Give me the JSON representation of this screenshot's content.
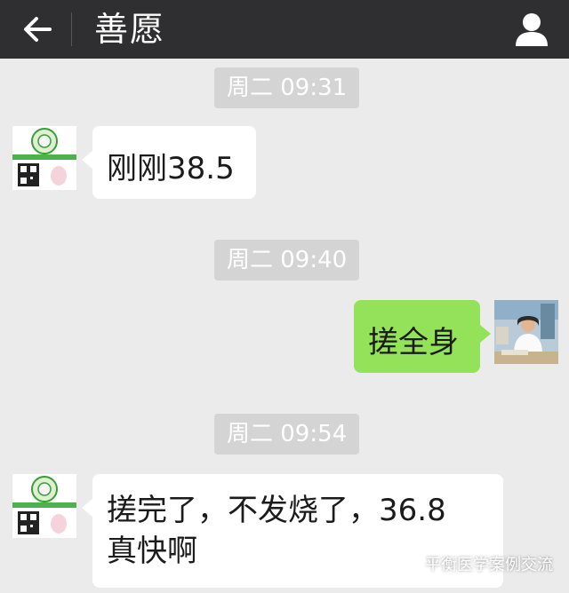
{
  "header": {
    "back_icon": "arrow-left-icon",
    "title": "善愿",
    "profile_icon": "person-icon"
  },
  "messages": [
    {
      "type": "time",
      "text": "周二 09:31"
    },
    {
      "type": "message",
      "side": "left",
      "text": "刚刚38.5"
    },
    {
      "type": "time",
      "text": "周二 09:40"
    },
    {
      "type": "message",
      "side": "right",
      "text": "搓全身"
    },
    {
      "type": "time",
      "text": "周二 09:54"
    },
    {
      "type": "message",
      "side": "left",
      "lines": [
        "搓完了，不发烧了，36.8",
        "真快啊"
      ]
    }
  ],
  "watermark": {
    "icon": "wechat-icon",
    "text": "平衡医学案例交流"
  },
  "colors": {
    "topbar": "#2f2f31",
    "background": "#ebebeb",
    "bubble_self": "#94e25a",
    "bubble_other": "#ffffff",
    "timestamp_bg": "#d4d4d4"
  }
}
